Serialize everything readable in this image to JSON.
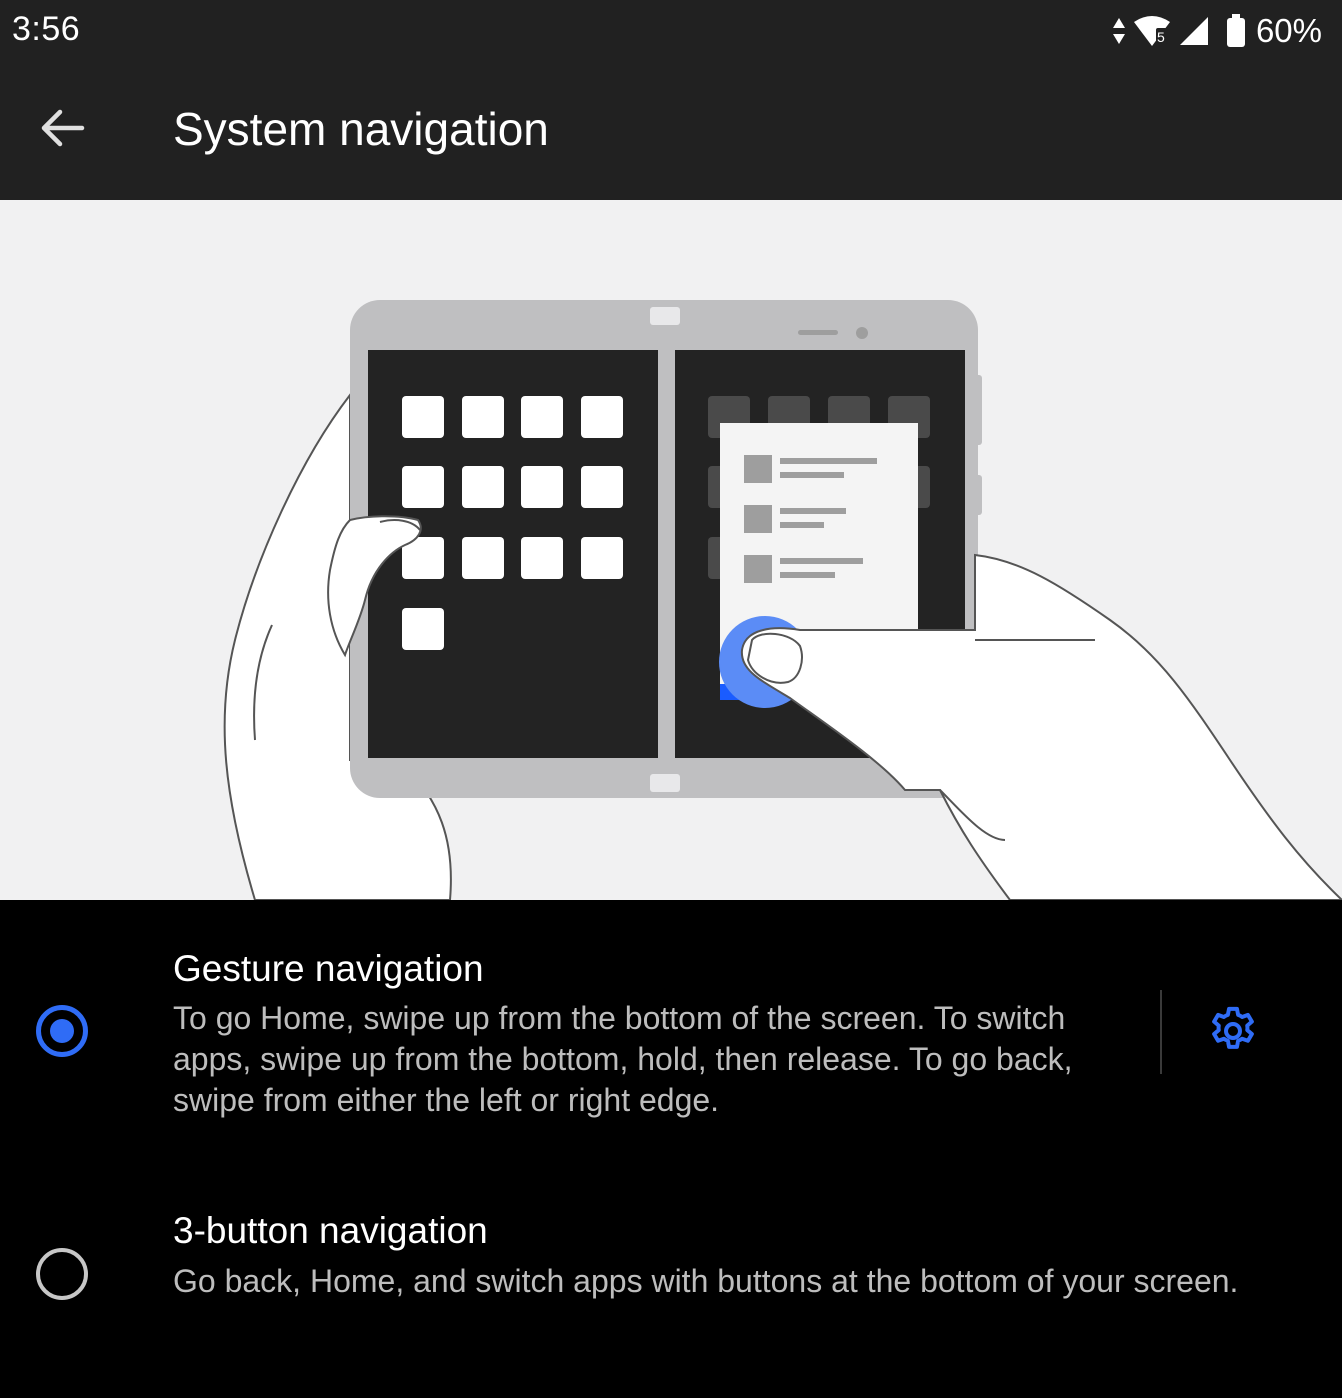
{
  "status_bar": {
    "time": "3:56",
    "battery_percent": "60%",
    "icons": [
      "data-arrows-icon",
      "wifi-icon",
      "cell-signal-icon",
      "battery-icon"
    ]
  },
  "app_bar": {
    "title": "System navigation",
    "back_icon": "arrow-back-icon"
  },
  "illustration": {
    "description_icon": "dual-screen-gesture-illustration"
  },
  "options": [
    {
      "title": "Gesture navigation",
      "description": "To go Home, swipe up from the bottom of the screen. To switch apps, swipe up from the bottom, hold, then release. To go back, swipe from either the left or right edge.",
      "selected": true,
      "settings_icon": "gear-icon"
    },
    {
      "title": "3-button navigation",
      "description": "Go back, Home, and switch apps with buttons at the bottom of your screen.",
      "selected": false
    }
  ],
  "colors": {
    "accent": "#2f6cf6",
    "bar_background": "#212121",
    "page_background": "#000000",
    "illustration_background": "#f1f1f2",
    "secondary_text": "#bdbdbd"
  }
}
